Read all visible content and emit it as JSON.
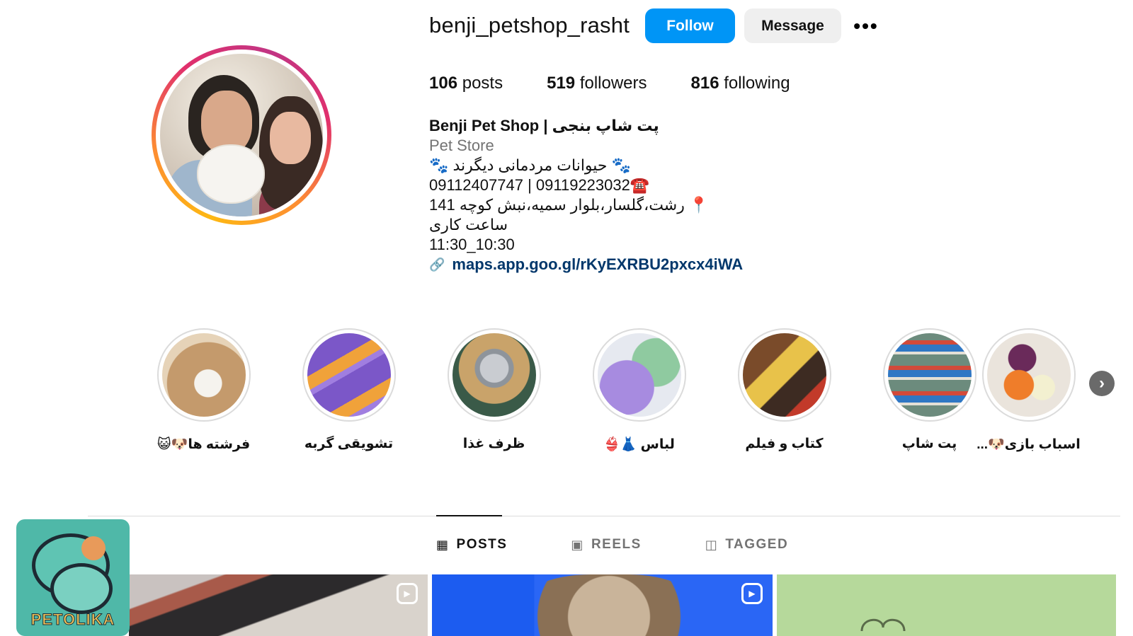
{
  "profile": {
    "username": "benji_petshop_rasht",
    "follow_label": "Follow",
    "message_label": "Message",
    "more_label": "•••",
    "stats": {
      "posts": "106",
      "posts_label": "posts",
      "followers": "519",
      "followers_label": "followers",
      "following": "816",
      "following_label": "following"
    },
    "bio": {
      "name": "Benji Pet Shop | پت شاپ بنجی",
      "category": "Pet Store",
      "line1": "🐾 حیوانات مردمانی دیگرند 🐾",
      "line2": "09112407747 | 09119223032☎️",
      "line3": "📍 رشت،گلسار،بلوار سمیه،نبش کوچه 141",
      "line4": "ساعت کاری",
      "line5": "11:30_10:30",
      "link": "maps.app.goo.gl/rKyEXRBU2pxcx4iWA"
    }
  },
  "highlights": [
    {
      "label": "فرشته ها🐶😺"
    },
    {
      "label": "تشویقی گربه"
    },
    {
      "label": "ظرف غذا"
    },
    {
      "label": "لباس 👗👙"
    },
    {
      "label": "کتاب و فیلم"
    },
    {
      "label": "پت شاپ"
    },
    {
      "label": "اسباب بازی🐶..."
    }
  ],
  "tabs": {
    "posts": "POSTS",
    "reels": "REELS",
    "tagged": "TAGGED"
  },
  "logo_text": "PETOLIKA",
  "colors": {
    "follow_blue": "#0095f6",
    "link_blue": "#00376b",
    "secondary_text": "#737373"
  },
  "icons": {
    "more": "more-options-icon",
    "link": "link-icon",
    "posts_tab": "grid-icon",
    "reels_tab": "reels-icon",
    "tagged_tab": "tagged-icon",
    "next": "chevron-right-icon"
  }
}
